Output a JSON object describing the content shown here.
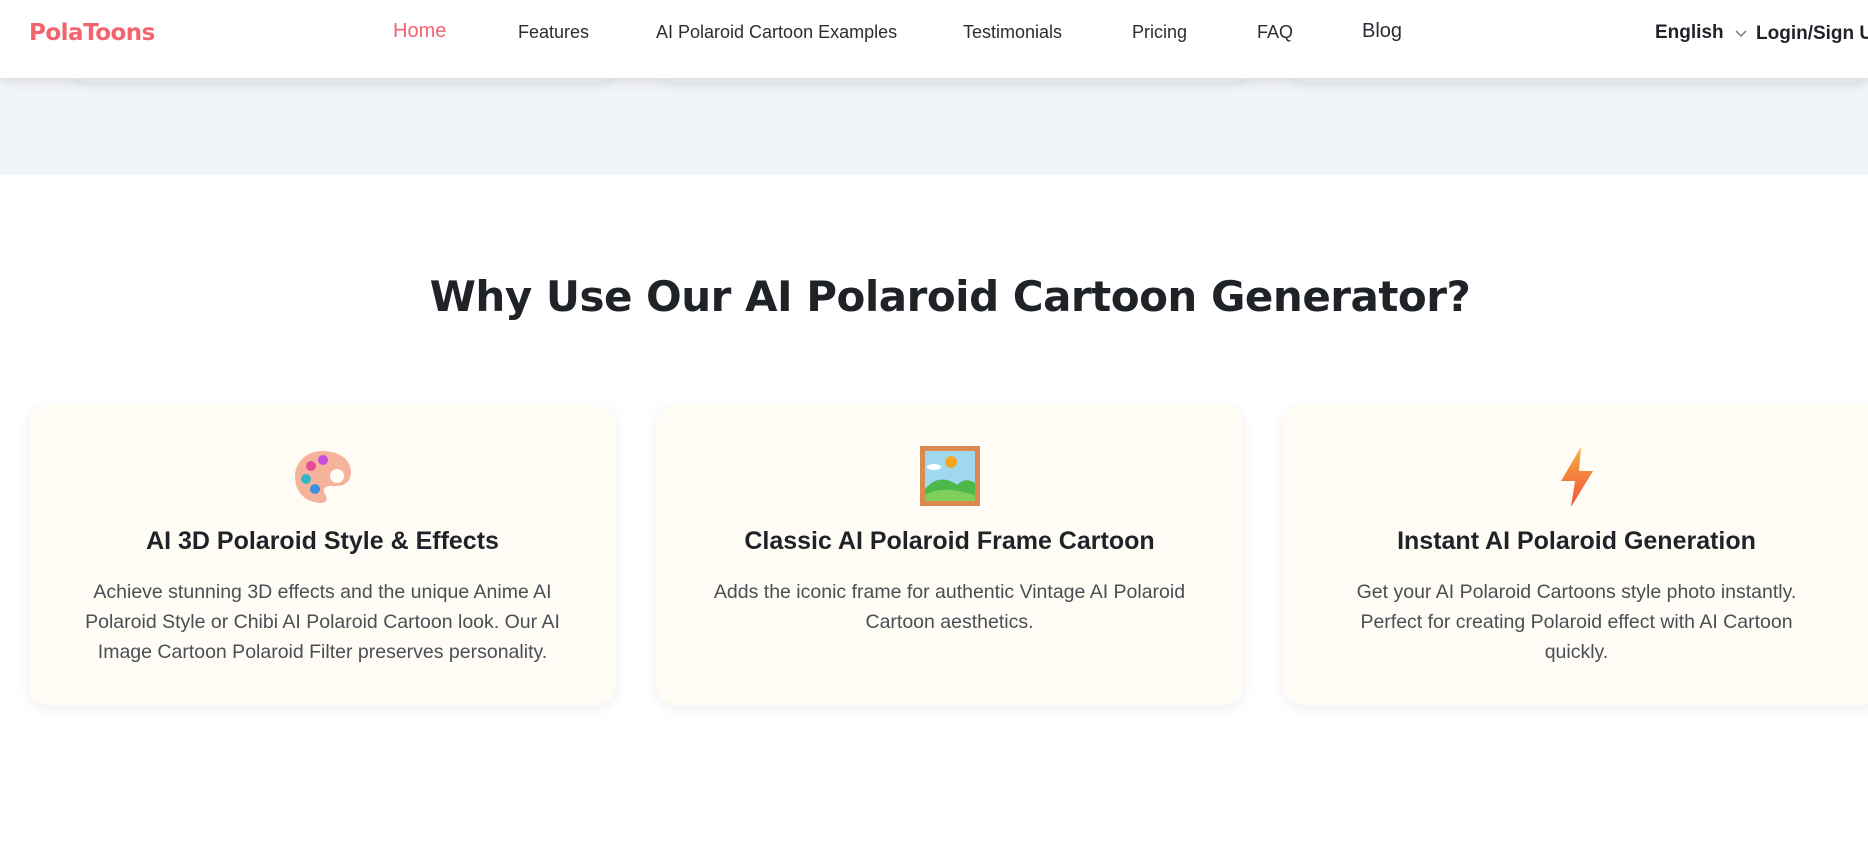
{
  "header": {
    "logo": "PolaToons",
    "nav": [
      {
        "label": "Home",
        "active": true
      },
      {
        "label": "Features"
      },
      {
        "label": "AI Polaroid Cartoon Examples"
      },
      {
        "label": "Testimonials"
      },
      {
        "label": "Pricing"
      },
      {
        "label": "FAQ"
      },
      {
        "label": "Blog"
      }
    ],
    "language": "English",
    "login": "Login/Sign Up"
  },
  "section": {
    "title": "Why Use Our AI Polaroid Cartoon Generator?"
  },
  "features": [
    {
      "icon": "palette-icon",
      "title": "AI 3D Polaroid Style & Effects",
      "desc": "Achieve stunning 3D effects and the unique Anime AI Polaroid Style or Chibi AI Polaroid Cartoon look. Our AI Image Cartoon Polaroid Filter preserves personality."
    },
    {
      "icon": "framed-picture-icon",
      "title": "Classic AI Polaroid Frame Cartoon",
      "desc": "Adds the iconic frame for authentic Vintage AI Polaroid Cartoon aesthetics."
    },
    {
      "icon": "lightning-icon",
      "title": "Instant AI Polaroid Generation",
      "desc": "Get your AI Polaroid Cartoons style photo instantly. Perfect for creating Polaroid effect with AI Cartoon quickly."
    }
  ],
  "colors": {
    "brand": "#f2646e",
    "band": "#f1f4f9",
    "card": "#fffcf5"
  }
}
